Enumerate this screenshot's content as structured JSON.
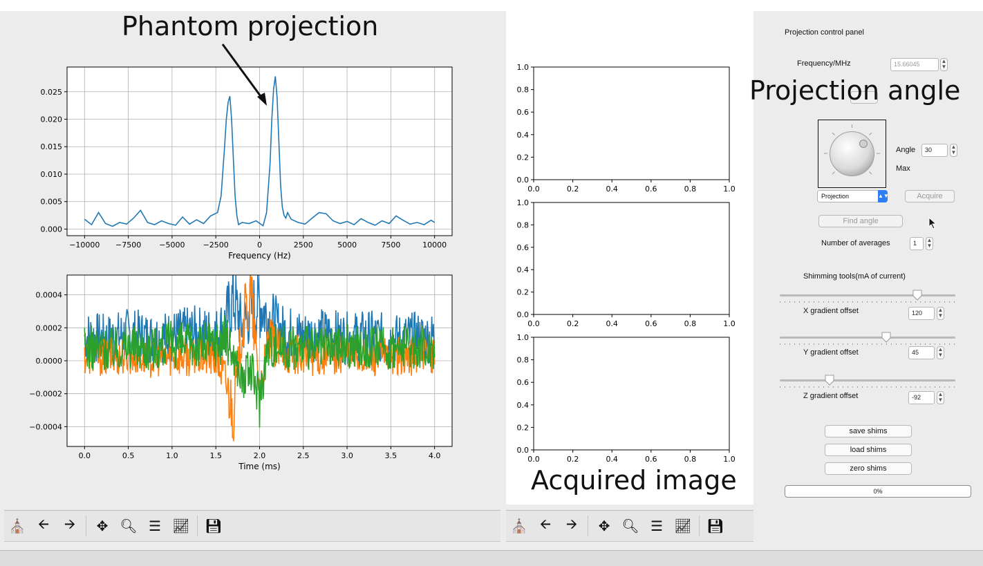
{
  "captions": {
    "phantom": "Phantom projection",
    "angle": "Projection angle",
    "acquired": "Acquired image"
  },
  "left_plots": {
    "top": {
      "xlabel": "Frequency (Hz)"
    },
    "bottom": {
      "xlabel": "Time (ms)"
    }
  },
  "toolbar_icons": [
    "home-icon",
    "back-arrow-icon",
    "forward-arrow-icon",
    "pan-icon",
    "zoom-icon",
    "configure-subplots-icon",
    "edit-axes-icon",
    "save-icon"
  ],
  "panel": {
    "title": "Projection control panel",
    "frequency_label": "Frequency/MHz",
    "frequency_value": "15.66045",
    "angle_label": "Angle",
    "angle_value": "30",
    "max_label": "Max",
    "mode_select": "Projection",
    "acquire_button": "Acquire",
    "find_angle_button": "Find angle",
    "averages_label": "Number of averages",
    "averages_value": "1",
    "shim_title": "Shimming tools(mA of current)",
    "x_label": "X gradient offset",
    "x_value": "120",
    "y_label": "Y gradient offset",
    "y_value": "45",
    "z_label": "Z gradient offset",
    "z_value": "-92",
    "save_shims": "save shims",
    "load_shims": "load shims",
    "zero_shims": "zero shims",
    "progress_text": "0%",
    "progress_value": 0
  },
  "chart_data": [
    {
      "type": "line",
      "xlabel": "Frequency (Hz)",
      "xlim": [
        -11000,
        11000
      ],
      "ylim": [
        -0.0012,
        0.0295
      ],
      "xticks": [
        -10000,
        -7500,
        -5000,
        -2500,
        0,
        2500,
        5000,
        7500,
        10000
      ],
      "xtick_labels": [
        "−10000",
        "−7500",
        "−5000",
        "−2500",
        "0",
        "2500",
        "5000",
        "7500",
        "10000"
      ],
      "yticks": [
        0.0,
        0.005,
        0.01,
        0.015,
        0.02,
        0.025
      ],
      "ytick_labels": [
        "0.000",
        "0.005",
        "0.010",
        "0.015",
        "0.020",
        "0.025"
      ],
      "grid": true,
      "series": [
        {
          "color": "#1f77b4",
          "x": [
            -10000,
            -9600,
            -9200,
            -8800,
            -8400,
            -8000,
            -7600,
            -7200,
            -6800,
            -6400,
            -6000,
            -5600,
            -5200,
            -4800,
            -4400,
            -4000,
            -3600,
            -3200,
            -2800,
            -2400,
            -2200,
            -2000,
            -1900,
            -1800,
            -1700,
            -1600,
            -1500,
            -1400,
            -1300,
            -1200,
            -1000,
            -600,
            -200,
            200,
            400,
            600,
            700,
            800,
            900,
            1000,
            1100,
            1200,
            1300,
            1400,
            1500,
            1600,
            1800,
            2200,
            2600,
            3000,
            3400,
            3800,
            4200,
            4600,
            5000,
            5400,
            5800,
            6200,
            6600,
            7000,
            7400,
            7800,
            8200,
            8600,
            9000,
            9400,
            9800,
            10000
          ],
          "y": [
            0.0018,
            0.0008,
            0.003,
            0.001,
            0.0005,
            0.0012,
            0.0009,
            0.002,
            0.0034,
            0.0012,
            0.0008,
            0.0015,
            0.001,
            0.0007,
            0.0022,
            0.0009,
            0.0017,
            0.001,
            0.0024,
            0.003,
            0.006,
            0.015,
            0.02,
            0.023,
            0.0242,
            0.02,
            0.013,
            0.006,
            0.0025,
            0.0008,
            0.0012,
            0.001,
            0.0015,
            0.0006,
            0.003,
            0.012,
            0.02,
            0.0255,
            0.0278,
            0.024,
            0.016,
            0.008,
            0.004,
            0.0025,
            0.002,
            0.003,
            0.0018,
            0.0012,
            0.0009,
            0.002,
            0.003,
            0.0028,
            0.0015,
            0.001,
            0.0014,
            0.0008,
            0.0019,
            0.0012,
            0.0007,
            0.0015,
            0.001,
            0.0024,
            0.0016,
            0.0009,
            0.0012,
            0.0008,
            0.0016,
            0.0012
          ]
        }
      ]
    },
    {
      "type": "line",
      "xlabel": "Time (ms)",
      "xlim": [
        -0.2,
        4.2
      ],
      "ylim": [
        -0.00052,
        0.00052
      ],
      "xticks": [
        0.0,
        0.5,
        1.0,
        1.5,
        2.0,
        2.5,
        3.0,
        3.5,
        4.0
      ],
      "xtick_labels": [
        "0.0",
        "0.5",
        "1.0",
        "1.5",
        "2.0",
        "2.5",
        "3.0",
        "3.5",
        "4.0"
      ],
      "yticks": [
        -0.0004,
        -0.0002,
        0.0,
        0.0002,
        0.0004
      ],
      "ytick_labels": [
        "−0.0004",
        "−0.0002",
        "0.0000",
        "0.0002",
        "0.0004"
      ],
      "grid": true,
      "series": [
        {
          "color": "#1f77b4",
          "x": [
            0.0,
            0.25,
            0.5,
            0.75,
            1.0,
            1.25,
            1.5,
            1.6,
            1.7,
            1.8,
            1.9,
            2.0,
            2.1,
            2.25,
            2.5,
            2.75,
            3.0,
            3.25,
            3.5,
            3.75,
            4.0
          ],
          "y": [
            0.00015,
            0.00013,
            0.00016,
            0.00014,
            0.00015,
            0.00017,
            0.00016,
            0.00022,
            0.00038,
            0.0002,
            0.0003,
            0.00035,
            0.00026,
            0.00018,
            0.00015,
            0.00016,
            0.00014,
            0.00015,
            0.00013,
            0.00014,
            0.00014
          ]
        },
        {
          "color": "#ff7f0e",
          "x": [
            0.0,
            0.25,
            0.5,
            0.75,
            1.0,
            1.25,
            1.5,
            1.6,
            1.7,
            1.8,
            1.9,
            2.0,
            2.1,
            2.25,
            2.5,
            2.75,
            3.0,
            3.25,
            3.5,
            3.75,
            4.0
          ],
          "y": [
            3e-05,
            2e-05,
            4e-05,
            1e-05,
            3e-05,
            2e-05,
            1e-05,
            -0.0001,
            -0.0003,
            0.0002,
            0.0004,
            -0.00018,
            0.00012,
            5e-05,
            3e-05,
            2e-05,
            4e-05,
            1e-05,
            3e-05,
            2e-05,
            3e-05
          ]
        },
        {
          "color": "#2ca02c",
          "x": [
            0.0,
            0.25,
            0.5,
            0.75,
            1.0,
            1.25,
            1.5,
            1.6,
            1.7,
            1.8,
            1.9,
            2.0,
            2.1,
            2.25,
            2.5,
            2.75,
            3.0,
            3.25,
            3.5,
            3.75,
            4.0
          ],
          "y": [
            8e-05,
            7e-05,
            9e-05,
            8e-05,
            0.0001,
            9e-05,
            0.00011,
            0.00014,
            4e-05,
            -0.00012,
            -6e-05,
            -0.00022,
            0.0001,
            9e-05,
            8e-05,
            7e-05,
            9e-05,
            8e-05,
            7e-05,
            8e-05,
            8e-05
          ]
        }
      ]
    },
    {
      "type": "line",
      "xlim": [
        0.0,
        1.0
      ],
      "ylim": [
        0.0,
        1.0
      ],
      "xticks": [
        0.0,
        0.2,
        0.4,
        0.6,
        0.8,
        1.0
      ],
      "xtick_labels": [
        "0.0",
        "0.2",
        "0.4",
        "0.6",
        "0.8",
        "1.0"
      ],
      "yticks": [
        0.0,
        0.2,
        0.4,
        0.6,
        0.8,
        1.0
      ],
      "ytick_labels": [
        "0.0",
        "0.2",
        "0.4",
        "0.6",
        "0.8",
        "1.0"
      ],
      "grid": false,
      "series": []
    },
    {
      "type": "line",
      "xlim": [
        0.0,
        1.0
      ],
      "ylim": [
        0.0,
        1.0
      ],
      "xticks": [
        0.0,
        0.2,
        0.4,
        0.6,
        0.8,
        1.0
      ],
      "xtick_labels": [
        "0.0",
        "0.2",
        "0.4",
        "0.6",
        "0.8",
        "1.0"
      ],
      "yticks": [
        0.0,
        0.2,
        0.4,
        0.6,
        0.8,
        1.0
      ],
      "ytick_labels": [
        "0.0",
        "0.2",
        "0.4",
        "0.6",
        "0.8",
        "1.0"
      ],
      "grid": false,
      "series": []
    },
    {
      "type": "line",
      "xlim": [
        0.0,
        1.0
      ],
      "ylim": [
        0.0,
        1.0
      ],
      "xticks": [
        0.0,
        0.2,
        0.4,
        0.6,
        0.8,
        1.0
      ],
      "xtick_labels": [
        "0.0",
        "0.2",
        "0.4",
        "0.6",
        "0.8",
        "1.0"
      ],
      "yticks": [
        0.0,
        0.2,
        0.4,
        0.6,
        0.8,
        1.0
      ],
      "ytick_labels": [
        "0.0",
        "0.2",
        "0.4",
        "0.6",
        "0.8",
        "1.0"
      ],
      "grid": false,
      "series": []
    }
  ]
}
